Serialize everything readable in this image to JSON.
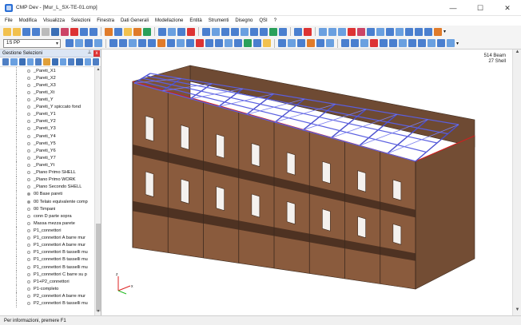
{
  "window": {
    "title": "CMP Dev - [Mur_L_SX-TE-01.cmp]",
    "min_label": "—",
    "max_label": "☐",
    "close_label": "✕"
  },
  "menu": [
    "File",
    "Modifica",
    "Visualizza",
    "Selezioni",
    "Finestra",
    "Dati Generali",
    "Modellazione",
    "Entità",
    "Strumenti",
    "Disegno",
    "QSI",
    "?"
  ],
  "toolbar": {
    "combo_value": "1S PP",
    "combo_arrow": "▾",
    "overflow_arrow": "▾"
  },
  "panel": {
    "title": "Gestione Selezioni",
    "pin_label": "⊥",
    "close_label": "x",
    "items": [
      "_Pareti_X1",
      "_Pareti_X2",
      "_Pareti_X3",
      "_Pareti_Xt",
      "_Pareti_Y",
      "_Pareti_Y spiccato fond",
      "_Pareti_Y1",
      "_Pareti_Y2",
      "_Pareti_Y3",
      "_Pareti_Y4",
      "_Pareti_Y5",
      "_Pareti_Y6",
      "_Pareti_Y7",
      "_Pareti_Yt",
      "_Piano Primo SHELL",
      "_Piano Primo WORK",
      "_Piano Secondo SHELL",
      "00 Base pareti",
      "00 Telaio equivalente comp",
      "00 Timpani",
      "conn D parte sopra",
      "Massa mezza parete",
      "P1_connettori",
      "P1_connettori A barre mur",
      "P1_connettori A barre mur",
      "P1_connettori B tasselli mu",
      "P1_connettori B tasselli mu",
      "P1_connettori B tasselli mu",
      "P1_connettori C barre su p",
      "P1+P2_connettori",
      "P1-completo",
      "P2_connettori A barre mur",
      "P2_connettori B tasselli mu"
    ]
  },
  "viewport": {
    "info_line1": "514 Beam",
    "info_line2": "27 Shell"
  },
  "status": {
    "text": "Per informazioni, premere F1"
  }
}
